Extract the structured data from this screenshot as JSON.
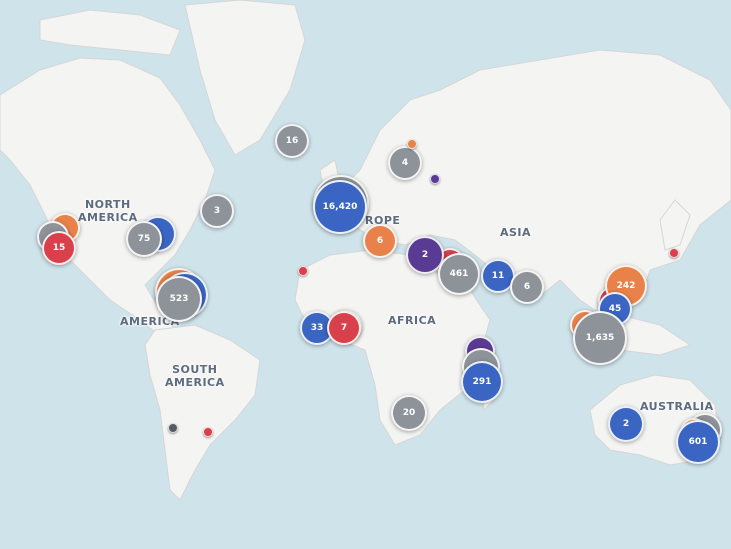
{
  "map": {
    "colors": {
      "water": "#cfe3ea",
      "land": "#f4f4f2",
      "border": "#d6d6d6"
    },
    "region_labels": {
      "north_america": "NORTH\nAMERICA",
      "europe": "ROPE",
      "asia": "ASIA",
      "central_america": "AMERICA",
      "africa": "AFRICA",
      "south_america": "SOUTH\nAMERICA",
      "australia": "AUSTRALIA"
    },
    "clusters": {
      "greenland_iceland": "16",
      "scandinavia": "4",
      "atlantic_canada": "3",
      "west_europe": "16,420",
      "east_us": "75",
      "west_coast": "15",
      "east_mediterranean": "6",
      "middle_east_purple": "2",
      "arabia": "461",
      "india": "11",
      "southeast_asia": "6",
      "south_china": "242",
      "philippines": "45",
      "indonesia": "1,635",
      "central_america": "523",
      "west_africa_blue": "33",
      "west_africa_red": "7",
      "east_africa": "291",
      "south_africa": "20",
      "west_australia": "2",
      "east_australia": "601"
    },
    "cluster_colors": {
      "gray": "#8e9399",
      "blue": "#3a65c3",
      "red": "#d8414b",
      "orange": "#e9824a",
      "purple": "#5a3b93"
    }
  }
}
